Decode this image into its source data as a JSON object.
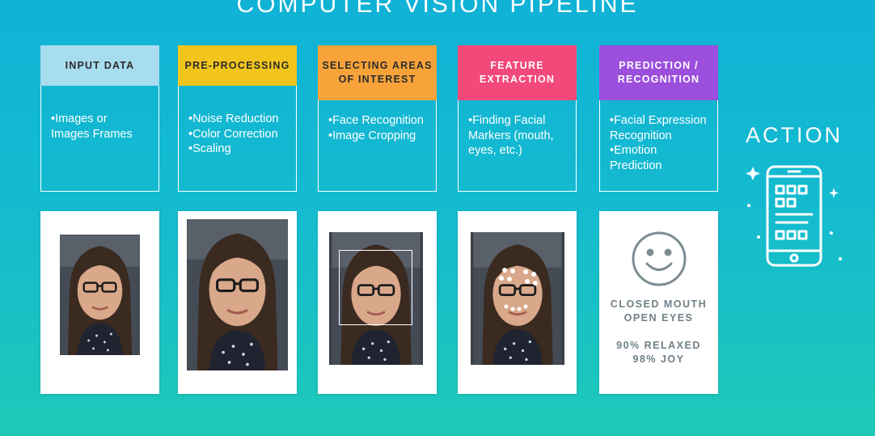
{
  "title": "COMPUTER VISION PIPELINE",
  "stages": [
    {
      "label": "INPUT DATA",
      "color": "#a8ddef",
      "bullets": [
        "•Images or",
        "Images Frames"
      ]
    },
    {
      "label": "PRE-PROCESSING",
      "color": "#f2c51c",
      "bullets": [
        "•Noise Reduction",
        "•Color Correction",
        "•Scaling"
      ]
    },
    {
      "label": "SELECTING AREAS OF INTEREST",
      "label_line1": "SELECTING AREAS",
      "label_line2": "OF INTEREST",
      "color": "#f7a33a",
      "bullets": [
        "•Face Recognition",
        "•Image Cropping"
      ]
    },
    {
      "label": "FEATURE EXTRACTION",
      "label_line1": "FEATURE",
      "label_line2": "EXTRACTION",
      "color": "#f2487a",
      "bullets": [
        "•Finding Facial",
        "Markers (mouth,",
        "eyes, etc.)"
      ]
    },
    {
      "label": "PREDICTION / RECOGNITION",
      "label_line1": "PREDICTION /",
      "label_line2": "RECOGNITION",
      "color": "#9b4fdc",
      "bullets": [
        "•Facial Expression",
        "Recognition",
        "•Emotion",
        "Prediction"
      ]
    }
  ],
  "result": {
    "line1": "CLOSED MOUTH",
    "line2": "OPEN EYES",
    "line3": "90% RELAXED",
    "line4": "98% JOY",
    "icon": "smiley-face-icon"
  },
  "action": {
    "label": "ACTION",
    "icon": "smartphone-app-icon"
  }
}
